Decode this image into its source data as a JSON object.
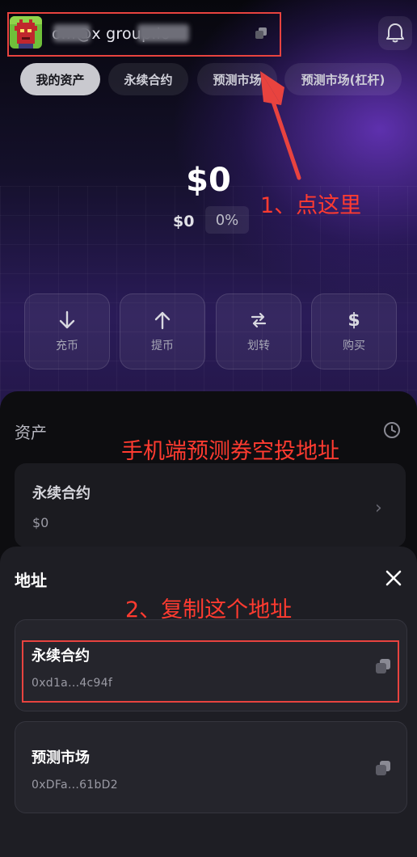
{
  "header": {
    "email": "o...@x group.io",
    "copy_icon": "copy-icon",
    "bell_icon": "bell-icon"
  },
  "tabs": [
    {
      "label": "我的资产",
      "active": true
    },
    {
      "label": "永续合约",
      "active": false
    },
    {
      "label": "预测市场",
      "active": false
    },
    {
      "label": "预测市场(杠杆)",
      "active": false
    }
  ],
  "balance": {
    "total": "$0",
    "change_amount": "$0",
    "change_percent": "0%"
  },
  "actions": [
    {
      "label": "充币",
      "icon": "arrow-down-icon"
    },
    {
      "label": "提币",
      "icon": "arrow-up-icon"
    },
    {
      "label": "划转",
      "icon": "transfer-icon"
    },
    {
      "label": "购买",
      "icon": "dollar-icon"
    }
  ],
  "assets": {
    "title": "资产",
    "card": {
      "name": "永续合约",
      "value": "$0"
    }
  },
  "sheet": {
    "title": "地址",
    "cards": [
      {
        "name": "永续合约",
        "address": "0xd1a...4c94f"
      },
      {
        "name": "预测市场",
        "address": "0xDFa...61bD2"
      }
    ]
  },
  "annotations": {
    "step1": "1、点这里",
    "heading": "手机端预测券空投地址",
    "step2": "2、复制这个地址"
  },
  "colors": {
    "annotation": "#e8433f",
    "active_tab": "#c9c9cf"
  }
}
